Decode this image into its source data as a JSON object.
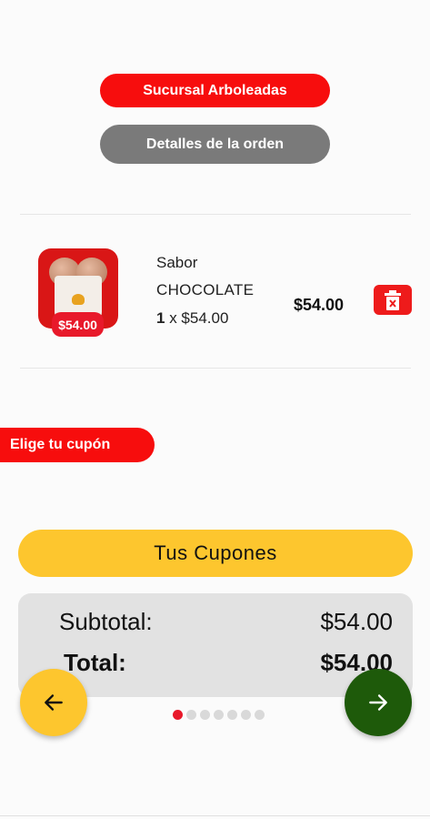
{
  "header": {
    "branch_label": "Sucursal Arboleadas",
    "details_label": "Detalles de la orden"
  },
  "order_item": {
    "image": "chocolate-ice-cream-cup",
    "price_badge": "$54.00",
    "flavor_label": "Sabor",
    "flavor_name": "CHOCOLATE",
    "quantity": "1",
    "unit_price": "x $54.00",
    "line_total": "$54.00",
    "delete_icon": "trash-icon"
  },
  "coupon": {
    "choose_label": "Elige tu cupón",
    "coupons_button": "Tus Cupones"
  },
  "summary": {
    "subtotal_label": "Subtotal:",
    "subtotal_value": "$54.00",
    "total_label": "Total:",
    "total_value": "$54.00"
  },
  "navigation": {
    "back_icon": "arrow-left-icon",
    "next_icon": "arrow-right-icon",
    "page_count": 7,
    "current_page": 1
  },
  "colors": {
    "primary_red": "#f70d0d",
    "gray_pill": "#7a7a7a",
    "yellow": "#fdc62e",
    "dark_green": "#1e5a0a"
  }
}
